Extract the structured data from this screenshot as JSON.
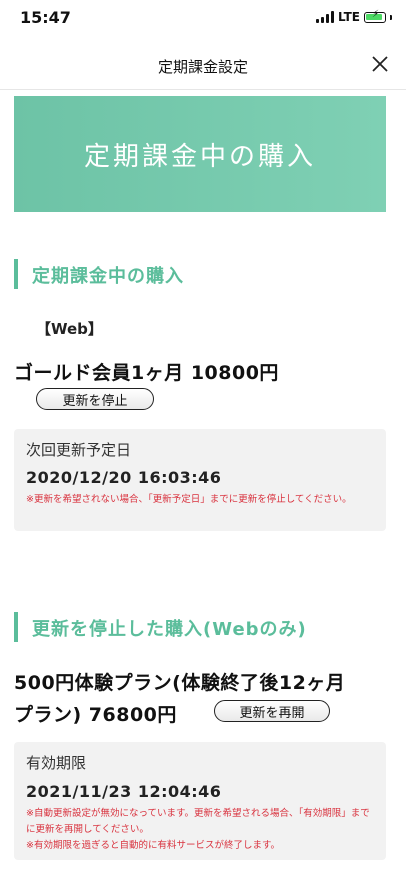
{
  "status_bar": {
    "time": "15:47",
    "network": "LTE"
  },
  "nav": {
    "title": "定期課金設定",
    "close": "×"
  },
  "hero": {
    "text": "定期課金中の購入"
  },
  "active_section": {
    "heading": "定期課金中の購入",
    "platform": "【Web】",
    "product": "ゴールド会員1ヶ月 10800円",
    "button": "更新を停止",
    "box": {
      "label": "次回更新予定日",
      "value": "2020/12/20 16:03:46",
      "note": "※更新を希望されない場合、「更新予定日」までに更新を停止してください。"
    }
  },
  "stopped_section": {
    "heading": "更新を停止した購入(Webのみ)",
    "product_line1": "500円体験プラン(体験終了後12ヶ月",
    "product_line2": "プラン) 76800円",
    "button": "更新を再開",
    "box": {
      "label": "有効期限",
      "value": "2021/11/23 12:04:46",
      "note1": "※自動更新設定が無効になっています。更新を希望される場合、「有効期限」までに更新を再開してください。",
      "note2": "※有効期限を過ぎると自動的に有料サービスが終了します。"
    }
  },
  "colors": {
    "accent": "#5bbd9b",
    "hero": "#6dc3a6",
    "warning": "#d9333f",
    "box_bg": "#f2f2f2"
  }
}
